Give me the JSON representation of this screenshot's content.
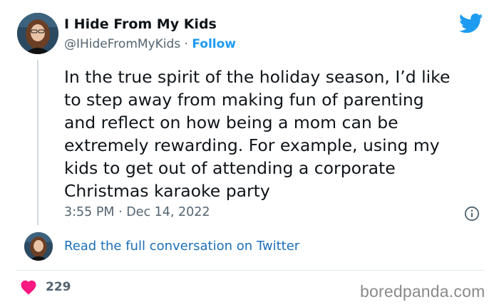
{
  "author": {
    "display_name": "I Hide From My Kids",
    "handle": "@IHideFromMyKids",
    "separator": "·",
    "follow_label": "Follow"
  },
  "tweet": {
    "lines": [
      "In the true spirit of the holiday season, I’d like",
      "to step away from making fun of parenting",
      "and reflect on how being a mom can be",
      "extremely rewarding. For example, using my",
      "kids to get out of attending a corporate",
      "Christmas karaoke party"
    ],
    "timestamp": "3:55 PM · Dec 14, 2022"
  },
  "footer": {
    "read_conversation": "Read the full conversation on Twitter",
    "like_count": "229"
  },
  "watermark": "boredpanda.com",
  "icons": {
    "brand": "twitter-bird-icon",
    "info": "info-icon",
    "like": "heart-icon"
  },
  "colors": {
    "twitter_blue": "#1d9bf0",
    "link": "#1d6fb8",
    "heart": "#f91880",
    "text": "#0f1419",
    "muted": "#536471"
  }
}
